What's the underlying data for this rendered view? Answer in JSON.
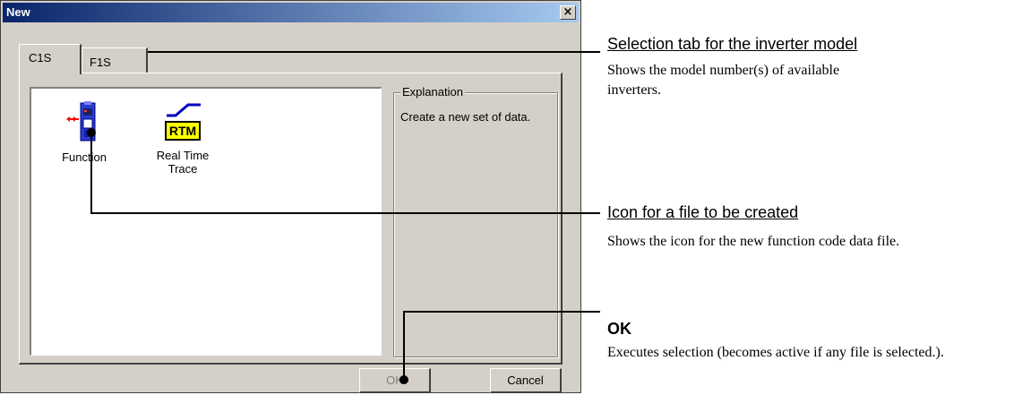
{
  "window": {
    "title": "New",
    "close_glyph": "×"
  },
  "tabs": [
    {
      "label": "C1S",
      "selected": true
    },
    {
      "label": "F1S",
      "selected": false
    }
  ],
  "icons": [
    {
      "icon": "inverter-icon",
      "label": "Function"
    },
    {
      "icon": "rtm-icon",
      "badge": "RTM",
      "label_line1": "Real Time",
      "label_line2": "Trace"
    }
  ],
  "explanation": {
    "title": "Explanation",
    "text": "Create a new set of data."
  },
  "buttons": {
    "ok": "OK",
    "cancel": "Cancel"
  },
  "annotations": [
    {
      "title": "Selection tab for the inverter model",
      "description": "Shows the model number(s) of available inverters."
    },
    {
      "title": "Icon for a file to be created",
      "description": "Shows the icon for the new function code data file."
    },
    {
      "title": "OK",
      "description": "Executes selection (becomes active if any file is selected.)."
    }
  ],
  "colors": {
    "title_bar_start": "#0a246a",
    "title_bar_end": "#a6caf0",
    "dialog_face": "#d4d0c8",
    "rtm_badge": "#ffff00"
  }
}
